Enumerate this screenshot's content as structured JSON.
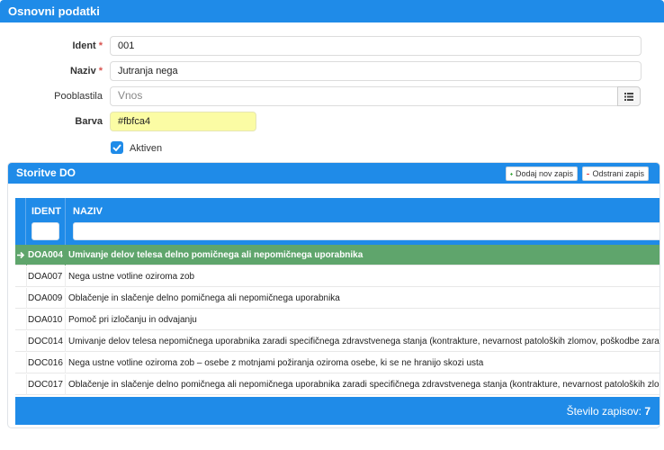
{
  "header": {
    "title": "Osnovni podatki"
  },
  "form": {
    "ident_label": "Ident",
    "ident_value": "001",
    "naziv_label": "Naziv",
    "naziv_value": "Jutranja nega",
    "required_mark": "*",
    "pooblastila_label": "Pooblastila",
    "pooblastila_placeholder": "Vnos",
    "barva_label": "Barva",
    "barva_value": "#fbfca4",
    "aktiven_label": "Aktiven",
    "aktiven_checked": true
  },
  "storitve": {
    "title": "Storitve DO",
    "add_label": "Dodaj nov zapis",
    "remove_label": "Odstrani zapis",
    "columns": {
      "ident": "IDENT",
      "naziv": "NAZIV"
    },
    "rows": [
      {
        "ident": "DOA004",
        "naziv": "Umivanje delov telesa delno pomičnega ali nepomičnega uporabnika",
        "selected": true
      },
      {
        "ident": "DOA007",
        "naziv": "Nega ustne votline oziroma zob"
      },
      {
        "ident": "DOA009",
        "naziv": "Oblačenje in slačenje delno pomičnega ali nepomičnega uporabnika"
      },
      {
        "ident": "DOA010",
        "naziv": "Pomoč pri izločanju in odvajanju"
      },
      {
        "ident": "DOC014",
        "naziv": "Umivanje delov telesa nepomičnega uporabnika zaradi specifičnega zdravstvenega stanja (kontrakture, nevarnost patoloških zlomov, poškodbe zaradi pritis"
      },
      {
        "ident": "DOC016",
        "naziv": "Nega ustne votline oziroma zob – osebe z motnjami požiranja oziroma osebe, ki se ne hranijo skozi usta"
      },
      {
        "ident": "DOC017",
        "naziv": "Oblačenje in slačenje delno pomičnega ali nepomičnega uporabnika zaradi specifičnega zdravstvenega stanja (kontrakture, nevarnost patoloških zlomov, ra"
      }
    ],
    "footer": {
      "count_label": "Število zapisov:",
      "count_value": "7"
    }
  },
  "colors": {
    "accent": "#1f8be8",
    "selected_row": "#5fa56c",
    "add": "#3aa63a",
    "remove": "#e03b3b"
  }
}
